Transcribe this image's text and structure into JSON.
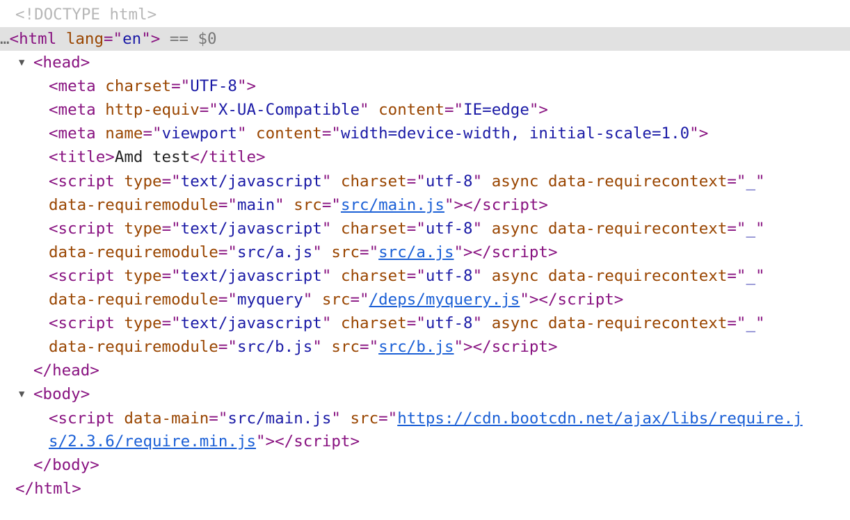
{
  "doctype": "<!DOCTYPE html>",
  "selected_marker": "== $0",
  "ellipsis": "…",
  "html_open": {
    "tag": "html",
    "attr": "lang",
    "value": "en"
  },
  "head": {
    "tag": "head",
    "meta1": {
      "attr": "charset",
      "value": "UTF-8"
    },
    "meta2": {
      "attr1": "http-equiv",
      "value1": "X-UA-Compatible",
      "attr2": "content",
      "value2": "IE=edge"
    },
    "meta3": {
      "attr1": "name",
      "value1": "viewport",
      "attr2": "content",
      "value2": "width=device-width, initial-scale=1.0"
    },
    "title_text": "Amd test",
    "scripts": [
      {
        "module": "main",
        "src": "src/main.js"
      },
      {
        "module": "src/a.js",
        "src": "src/a.js"
      },
      {
        "module": "myquery",
        "src": "/deps/myquery.js"
      },
      {
        "module": "src/b.js",
        "src": "src/b.js"
      }
    ],
    "script_type": "text/javascript",
    "script_charset": "utf-8",
    "script_async": "async",
    "script_context_attr": "data-requirecontext",
    "script_context_value": "_",
    "script_module_attr": "data-requiremodule"
  },
  "body": {
    "tag": "body",
    "script": {
      "main_attr": "data-main",
      "main_value": "src/main.js",
      "src_part1": "https://cdn.bootcdn.net/ajax/libs/require.j",
      "src_part2": "s/2.3.6/require.min.js"
    }
  }
}
